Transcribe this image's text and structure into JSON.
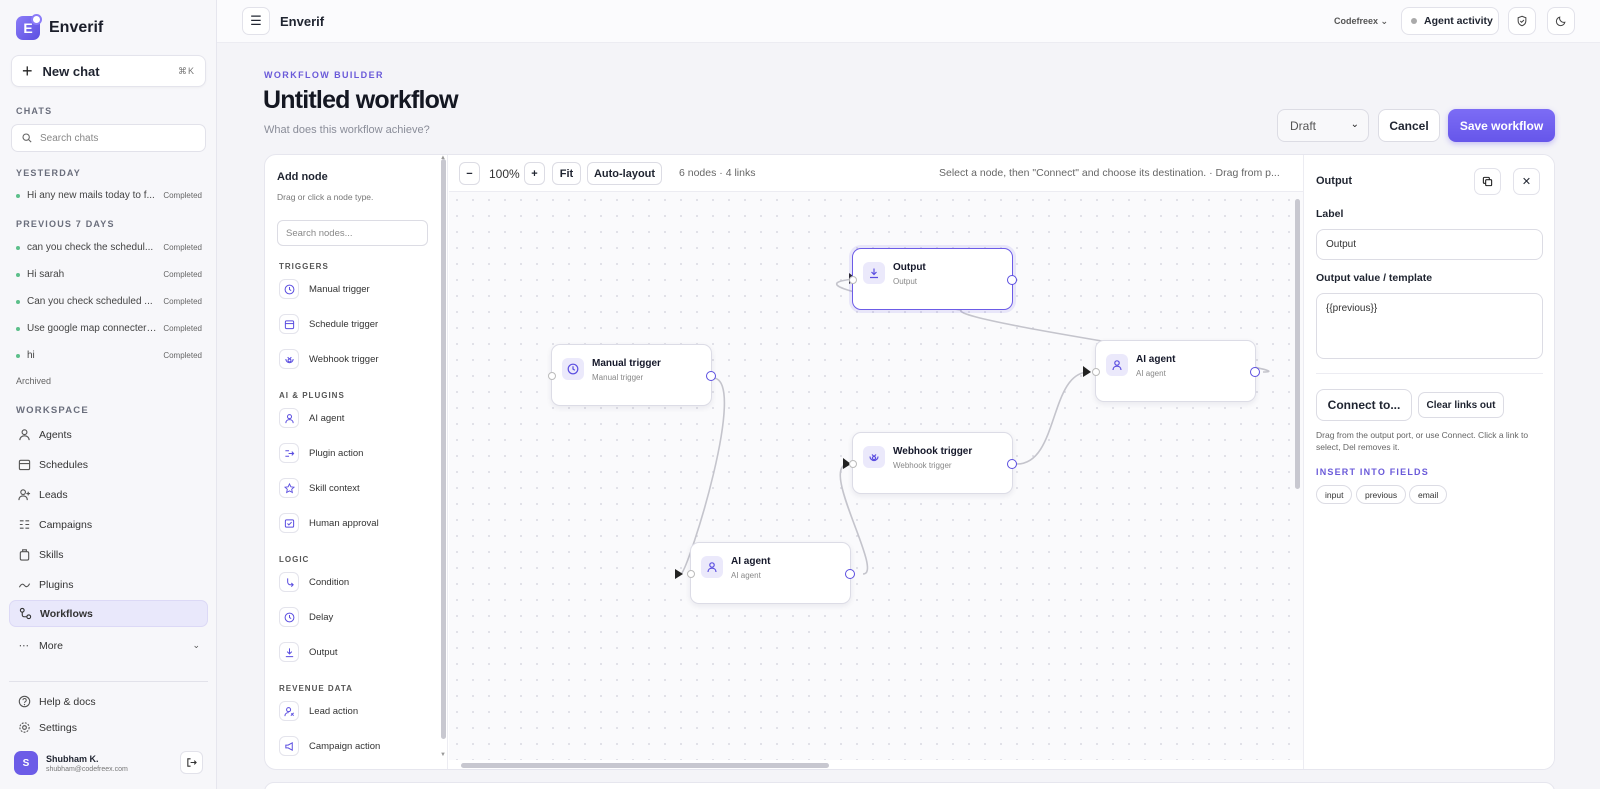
{
  "brand": {
    "name": "Enverif",
    "logo_letter": "E"
  },
  "sidebar": {
    "new_chat": {
      "label": "New chat",
      "shortcut": "⌘K"
    },
    "chats_label": "CHATS",
    "search_placeholder": "Search chats",
    "groups": [
      {
        "label": "YESTERDAY",
        "items": [
          {
            "title": "Hi any new mails today to f...",
            "status": "Completed"
          }
        ]
      },
      {
        "label": "PREVIOUS 7 DAYS",
        "items": [
          {
            "title": "can you check the schedul...",
            "status": "Completed"
          },
          {
            "title": "Hi sarah",
            "status": "Completed"
          },
          {
            "title": "Can you check scheduled ...",
            "status": "Completed"
          },
          {
            "title": "Use google map connecter ...",
            "status": "Completed"
          },
          {
            "title": "hi",
            "status": "Completed"
          }
        ]
      }
    ],
    "archived": "Archived",
    "workspace_label": "WORKSPACE",
    "nav": [
      {
        "label": "Agents",
        "icon": "user-icon"
      },
      {
        "label": "Schedules",
        "icon": "calendar-icon"
      },
      {
        "label": "Leads",
        "icon": "user-plus-icon"
      },
      {
        "label": "Campaigns",
        "icon": "list-icon"
      },
      {
        "label": "Skills",
        "icon": "box-icon"
      },
      {
        "label": "Plugins",
        "icon": "plug-icon"
      },
      {
        "label": "Workflows",
        "icon": "workflow-icon",
        "active": true
      },
      {
        "label": "More",
        "icon": "more-icon"
      }
    ],
    "footer": [
      {
        "label": "Help & docs",
        "icon": "help-icon"
      },
      {
        "label": "Settings",
        "icon": "gear-icon"
      }
    ],
    "user": {
      "initial": "S",
      "name": "Shubham K.",
      "email": "shubham@codefreex.com"
    }
  },
  "topbar": {
    "title": "Enverif",
    "workspace": "Codefreex",
    "agent_activity": "Agent activity"
  },
  "header": {
    "eyebrow": "WORKFLOW BUILDER",
    "title": "Untitled workflow",
    "subtitle_placeholder": "What does this workflow achieve?",
    "status": "Draft",
    "cancel": "Cancel",
    "save": "Save workflow"
  },
  "palette": {
    "title": "Add node",
    "subtitle": "Drag or click a node type.",
    "search_placeholder": "Search nodes...",
    "sections": [
      {
        "label": "TRIGGERS",
        "items": [
          "Manual trigger",
          "Schedule trigger",
          "Webhook trigger"
        ]
      },
      {
        "label": "AI & PLUGINS",
        "items": [
          "AI agent",
          "Plugin action",
          "Skill context",
          "Human approval"
        ]
      },
      {
        "label": "LOGIC",
        "items": [
          "Condition",
          "Delay",
          "Output"
        ]
      },
      {
        "label": "REVENUE DATA",
        "items": [
          "Lead action",
          "Campaign action"
        ]
      }
    ]
  },
  "toolbar": {
    "zoom_out": "−",
    "zoom": "100%",
    "zoom_in": "+",
    "fit": "Fit",
    "auto_layout": "Auto-layout",
    "meta": "6 nodes · 4 links",
    "hint": "Select a node, then \"Connect\" and choose its destination. · Drag from p..."
  },
  "nodes": [
    {
      "id": "output",
      "title": "Output",
      "subtitle": "Output",
      "selected": true
    },
    {
      "id": "manual",
      "title": "Manual trigger",
      "subtitle": "Manual trigger"
    },
    {
      "id": "agent1",
      "title": "AI agent",
      "subtitle": "AI agent"
    },
    {
      "id": "webhook",
      "title": "Webhook trigger",
      "subtitle": "Webhook trigger"
    },
    {
      "id": "agent2",
      "title": "AI agent",
      "subtitle": "AI agent"
    }
  ],
  "inspector": {
    "title": "Output",
    "label_label": "Label",
    "label_value": "Output",
    "value_label": "Output value / template",
    "value_value": "{{previous}}",
    "connect": "Connect to...",
    "clear": "Clear links out",
    "help": "Drag from the output port, or use Connect. Click a link to select, Del removes it.",
    "insert_label": "INSERT INTO FIELDS",
    "chips": [
      "input",
      "previous",
      "email"
    ]
  },
  "colors": {
    "accent": "#6c5ce7",
    "status_dot": "#5cbf8a"
  }
}
